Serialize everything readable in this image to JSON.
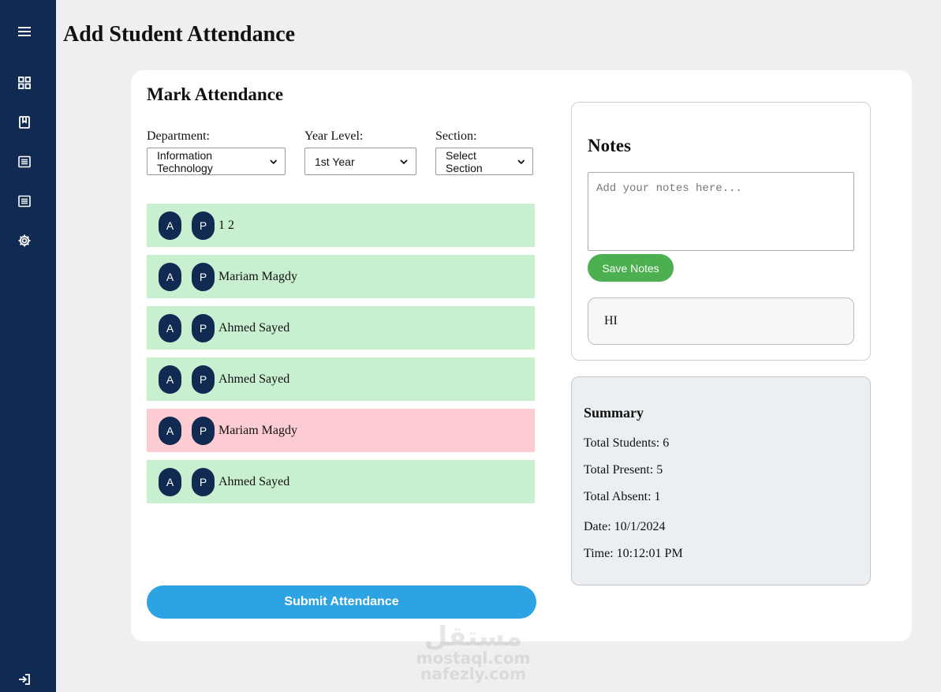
{
  "page": {
    "title": "Add Student Attendance"
  },
  "sidebar": {
    "items": [
      {
        "name": "menu-icon"
      },
      {
        "name": "dashboard-icon"
      },
      {
        "name": "book-icon"
      },
      {
        "name": "list-icon"
      },
      {
        "name": "report-icon"
      },
      {
        "name": "gear-icon"
      },
      {
        "name": "logout-icon"
      }
    ]
  },
  "mark": {
    "title": "Mark Attendance",
    "filters": {
      "department_label": "Department:",
      "department_value": "Information Technology",
      "year_label": "Year Level:",
      "year_value": "1st Year",
      "section_label": "Section:",
      "section_value": "Select Section"
    },
    "absent_label": "A",
    "present_label": "P",
    "students": [
      {
        "name": "1 2",
        "status": "present"
      },
      {
        "name": "Mariam Magdy",
        "status": "present"
      },
      {
        "name": "Ahmed Sayed",
        "status": "present"
      },
      {
        "name": "Ahmed Sayed",
        "status": "present"
      },
      {
        "name": "Mariam Magdy",
        "status": "absent"
      },
      {
        "name": "Ahmed Sayed",
        "status": "present"
      }
    ],
    "submit_label": "Submit Attendance"
  },
  "notes": {
    "title": "Notes",
    "placeholder": "Add your notes here...",
    "value": "",
    "save_label": "Save Notes",
    "saved": [
      "HI"
    ]
  },
  "summary": {
    "title": "Summary",
    "total_students": "Total Students: 6",
    "total_present": "Total Present: 5",
    "total_absent": "Total Absent: 1",
    "date": "Date: 10/1/2024",
    "time": "Time: 10:12:01 PM"
  },
  "watermark": {
    "line1": "مستقل",
    "line2": "mostaql.com",
    "line3": "nafezly.com"
  },
  "colors": {
    "sidebar": "#102a52",
    "present_row": "#c8efd0",
    "absent_row": "#fdccd2",
    "submit": "#2ea3e3",
    "save": "#4caf50"
  }
}
